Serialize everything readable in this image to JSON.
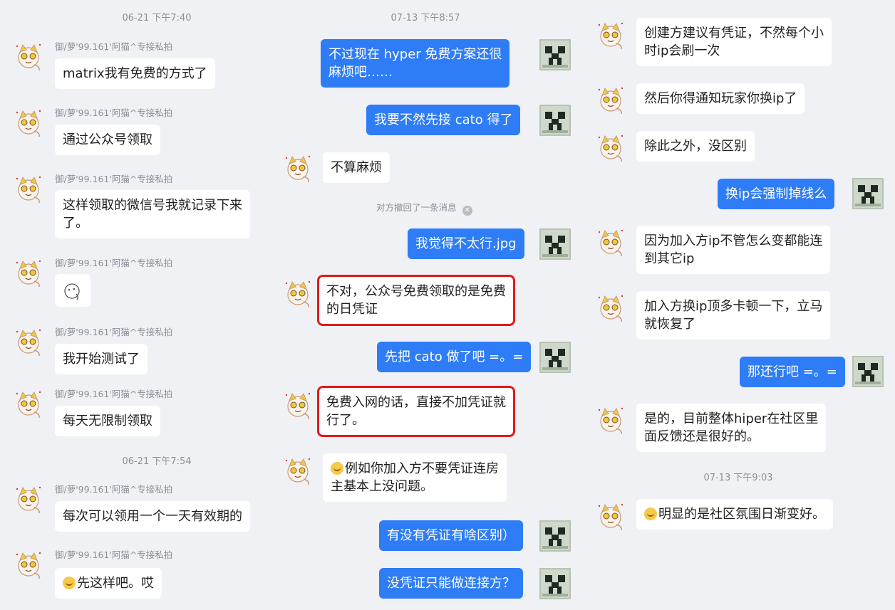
{
  "sender_name": "御/萝'99.161'阿猫^专接私拍",
  "columns": [
    {
      "times": [
        "06-21 下午7:40",
        "06-21 下午7:54"
      ],
      "messages": [
        "matrix我有免费的方式了",
        "通过公众号领取",
        "这样领取的微信号我就记录下来",
        "了。",
        "我开始测试了",
        "每天无限制领取",
        "每次可以领用一个一天有效期的",
        "先这样吧。哎"
      ]
    },
    {
      "times": [
        "07-13 下午8:57"
      ],
      "messages": [
        "不过现在 hyper 免费方案还很",
        "麻烦吧……",
        "我要不然先接 cato 得了",
        "不算麻烦",
        "我觉得不太行.jpg",
        "不对，公众号免费领取的是免费",
        "的日凭证",
        "先把 cato 做了吧 =。=",
        "免费入网的话，直接不加凭证就",
        "行了。",
        "例如你加入方不要凭证连房",
        "主基本上没问题。",
        "有没有凭证有啥区别）",
        "没凭证只能做连接方？"
      ],
      "recall_notice": "对方撤回了一条消息"
    },
    {
      "times": [
        "07-13 下午9:03"
      ],
      "messages": [
        "创建方建议有凭证，不然每个小",
        "时ip会刷一次",
        "然后你得通知玩家你换ip了",
        "除此之外，没区别",
        "换ip会强制掉线么",
        "因为加入方ip不管怎么变都能连",
        "到其它ip",
        "加入方换ip顶多卡顿一下，立马",
        "就恢复了",
        "那还行吧 =。=",
        "是的，目前整体hiper在社区里",
        "面反馈还是很好的。",
        "明显的是社区氛围日渐变好。"
      ]
    }
  ],
  "colors": {
    "self_bubble": "#2e7cf6",
    "other_bubble": "#ffffff",
    "highlight": "#e11a1a",
    "background": "#f0f1f5"
  },
  "icons": [
    "cat-avatar",
    "creeper-avatar",
    "close-icon",
    "smile-emoji-icon"
  ]
}
